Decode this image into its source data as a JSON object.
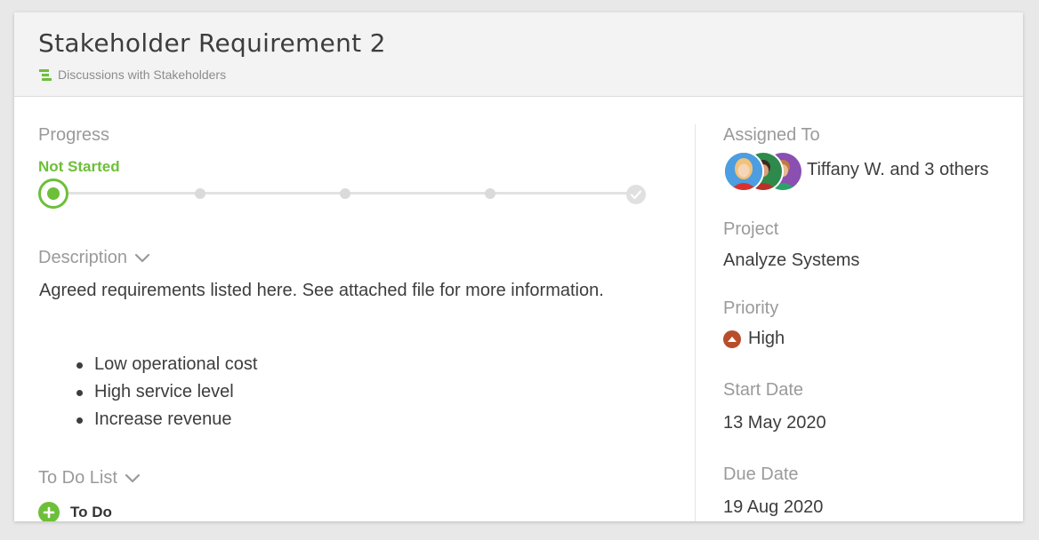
{
  "header": {
    "title": "Stakeholder Requirement 2",
    "breadcrumb": "Discussions with Stakeholders"
  },
  "progress": {
    "label": "Progress",
    "status": "Not Started",
    "current_step": 1,
    "total_steps": 5
  },
  "description": {
    "label": "Description",
    "text": "Agreed requirements listed here. See attached file for more information.",
    "bullets": [
      "Low operational cost",
      "High service level",
      "Increase revenue"
    ]
  },
  "todo": {
    "label": "To Do List",
    "add_label": "To Do"
  },
  "sidebar": {
    "assigned_label": "Assigned To",
    "assigned_text": "Tiffany W. and 3 others",
    "project_label": "Project",
    "project_value": "Analyze Systems",
    "priority_label": "Priority",
    "priority_value": "High",
    "start_label": "Start Date",
    "start_value": "13 May 2020",
    "due_label": "Due Date",
    "due_value": "19 Aug 2020"
  },
  "colors": {
    "accent": "#6dbf3a",
    "priority_high": "#b84d2c",
    "text": "#3d3d3d",
    "label": "#9a9a9a"
  },
  "icons": {
    "breadcrumb": "hierarchy-icon",
    "chevron": "chevron-down-icon",
    "check": "check-icon",
    "add": "plus-circle-icon",
    "priority": "priority-up-icon"
  }
}
